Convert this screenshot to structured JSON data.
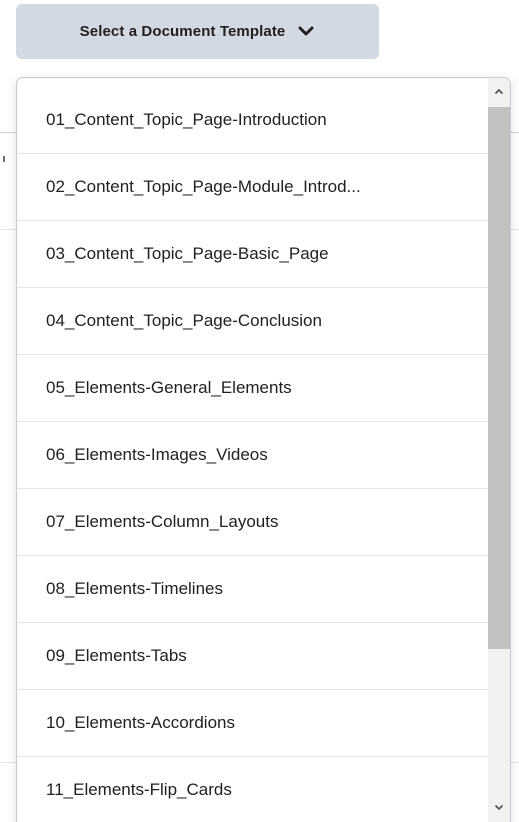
{
  "toolbar": {
    "template_button_label": "Select a Document Template"
  },
  "dropdown": {
    "items": [
      "01_Content_Topic_Page-Introduction",
      "02_Content_Topic_Page-Module_Introd...",
      "03_Content_Topic_Page-Basic_Page",
      "04_Content_Topic_Page-Conclusion",
      "05_Elements-General_Elements",
      "06_Elements-Images_Videos",
      "07_Elements-Column_Layouts",
      "08_Elements-Timelines",
      "09_Elements-Tabs",
      "10_Elements-Accordions",
      "11_Elements-Flip_Cards"
    ]
  },
  "icons": {
    "button_icon": "chevron-down-icon",
    "scroll_up": "scroll-up-arrow-icon",
    "scroll_down": "scroll-down-arrow-icon"
  },
  "colors": {
    "button_bg": "#d3d9e3",
    "text": "#202122",
    "divider": "#e4e6e9",
    "scroll_thumb": "#c1c1c1"
  }
}
